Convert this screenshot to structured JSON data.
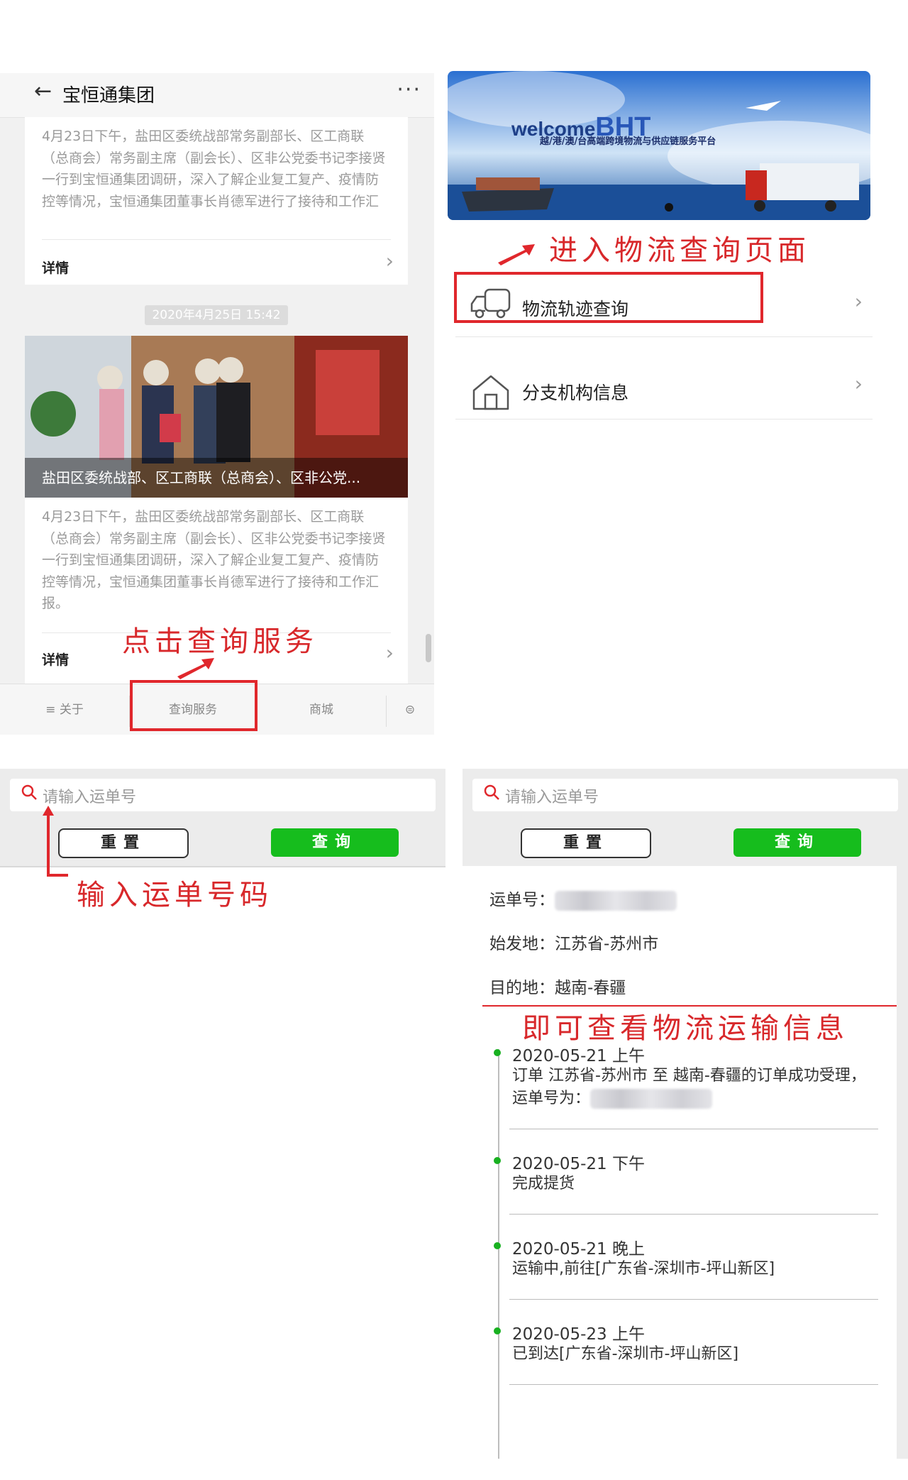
{
  "wechat": {
    "nav_title": "宝恒通集团",
    "article_excerpt": "4月23日下午，盐田区委统战部常务副部长、区工商联（总商会）常务副主席（副会长）、区非公党委书记李接贤一行到宝恒通集团调研，深入了解企业复工复产、疫情防控等情况，宝恒通集团董事长肖德军进行了接待和工作汇报。",
    "detail_label": "详情",
    "timestamp": "2020年4月25日 15:42",
    "photo_caption": "盐田区委统战部、区工商联（总商会）、区非公党...",
    "tabs": [
      "关于",
      "查询服务",
      "商城"
    ]
  },
  "annotations": {
    "click_query": "点击查询服务",
    "enter_page": "进入物流查询页面",
    "input_number": "输入运单号码",
    "view_info": "即可查看物流运输信息"
  },
  "service": {
    "banner_welcome": "welcome",
    "banner_brand": "BHT",
    "banner_subtitle": "越/港/澳/台高端跨境物流与供应链服务平台",
    "menu": [
      "物流轨迹查询",
      "分支机构信息"
    ]
  },
  "search": {
    "placeholder": "请输入运单号",
    "reset_label": "重置",
    "query_label": "查询"
  },
  "result": {
    "waybill_label": "运单号：",
    "origin": "始发地：江苏省-苏州市",
    "destination": "目的地：越南-春疆",
    "events": [
      {
        "time": "2020-05-21 上午",
        "desc": "订单 江苏省-苏州市 至 越南-春疆的订单成功受理，运单号为："
      },
      {
        "time": "2020-05-21 下午",
        "desc": "完成提货"
      },
      {
        "time": "2020-05-21 晚上",
        "desc": "运输中,前往[广东省-深圳市-坪山新区]"
      },
      {
        "time": "2020-05-23 上午",
        "desc": "已到达[广东省-深圳市-坪山新区]"
      }
    ]
  },
  "colors": {
    "accent_red": "#e0272c",
    "query_green": "#16bd1d"
  }
}
